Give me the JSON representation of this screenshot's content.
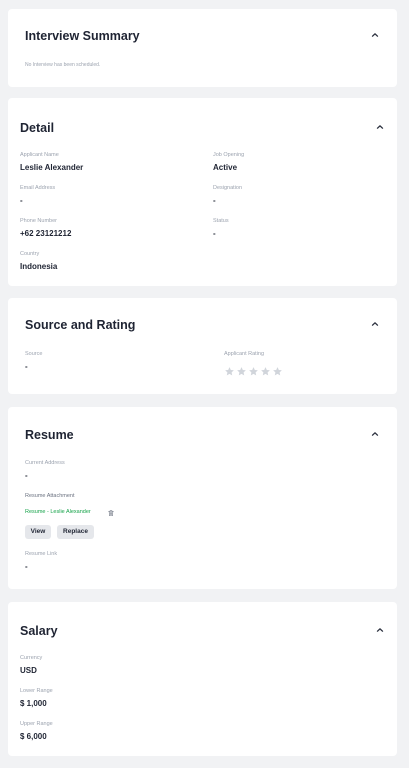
{
  "interview_summary": {
    "title": "Interview Summary",
    "empty_message": "No Interview has been scheduled."
  },
  "detail": {
    "title": "Detail",
    "fields": {
      "applicant_name": {
        "label": "Applicant Name",
        "value": "Leslie Alexander"
      },
      "job_opening": {
        "label": "Job Opening",
        "value": "Active"
      },
      "email_address": {
        "label": "Email Address",
        "value": "-"
      },
      "designation": {
        "label": "Designation",
        "value": "-"
      },
      "phone_number": {
        "label": "Phone Number",
        "value": "+62 23121212"
      },
      "status": {
        "label": "Status",
        "value": "-"
      },
      "country": {
        "label": "Country",
        "value": "Indonesia"
      }
    }
  },
  "source_rating": {
    "title": "Source and Rating",
    "source": {
      "label": "Source",
      "value": "-"
    },
    "rating": {
      "label": "Applicant Rating",
      "value": 0,
      "max": 5
    }
  },
  "resume": {
    "title": "Resume",
    "current_address": {
      "label": "Current Address",
      "value": "-"
    },
    "attachment_label": "Resume Attachment",
    "attachment_file": "Resume - Leslie Alexander",
    "view_label": "View",
    "replace_label": "Replace",
    "resume_link": {
      "label": "Resume Link",
      "value": "-"
    }
  },
  "salary": {
    "title": "Salary",
    "currency": {
      "label": "Currency",
      "value": "USD"
    },
    "lower_range": {
      "label": "Lower Range",
      "value": "$ 1,000"
    },
    "upper_range": {
      "label": "Upper Range",
      "value": "$ 6,000"
    }
  },
  "colors": {
    "page_bg": "#f1f2f4",
    "card_bg": "#ffffff",
    "accent_green": "#16a34a",
    "star_empty": "#d1d5db",
    "button_bg": "#e5e7eb"
  },
  "icons": {
    "collapse": "chevron-up-icon",
    "delete": "trash-icon",
    "rating": "star-icon"
  }
}
